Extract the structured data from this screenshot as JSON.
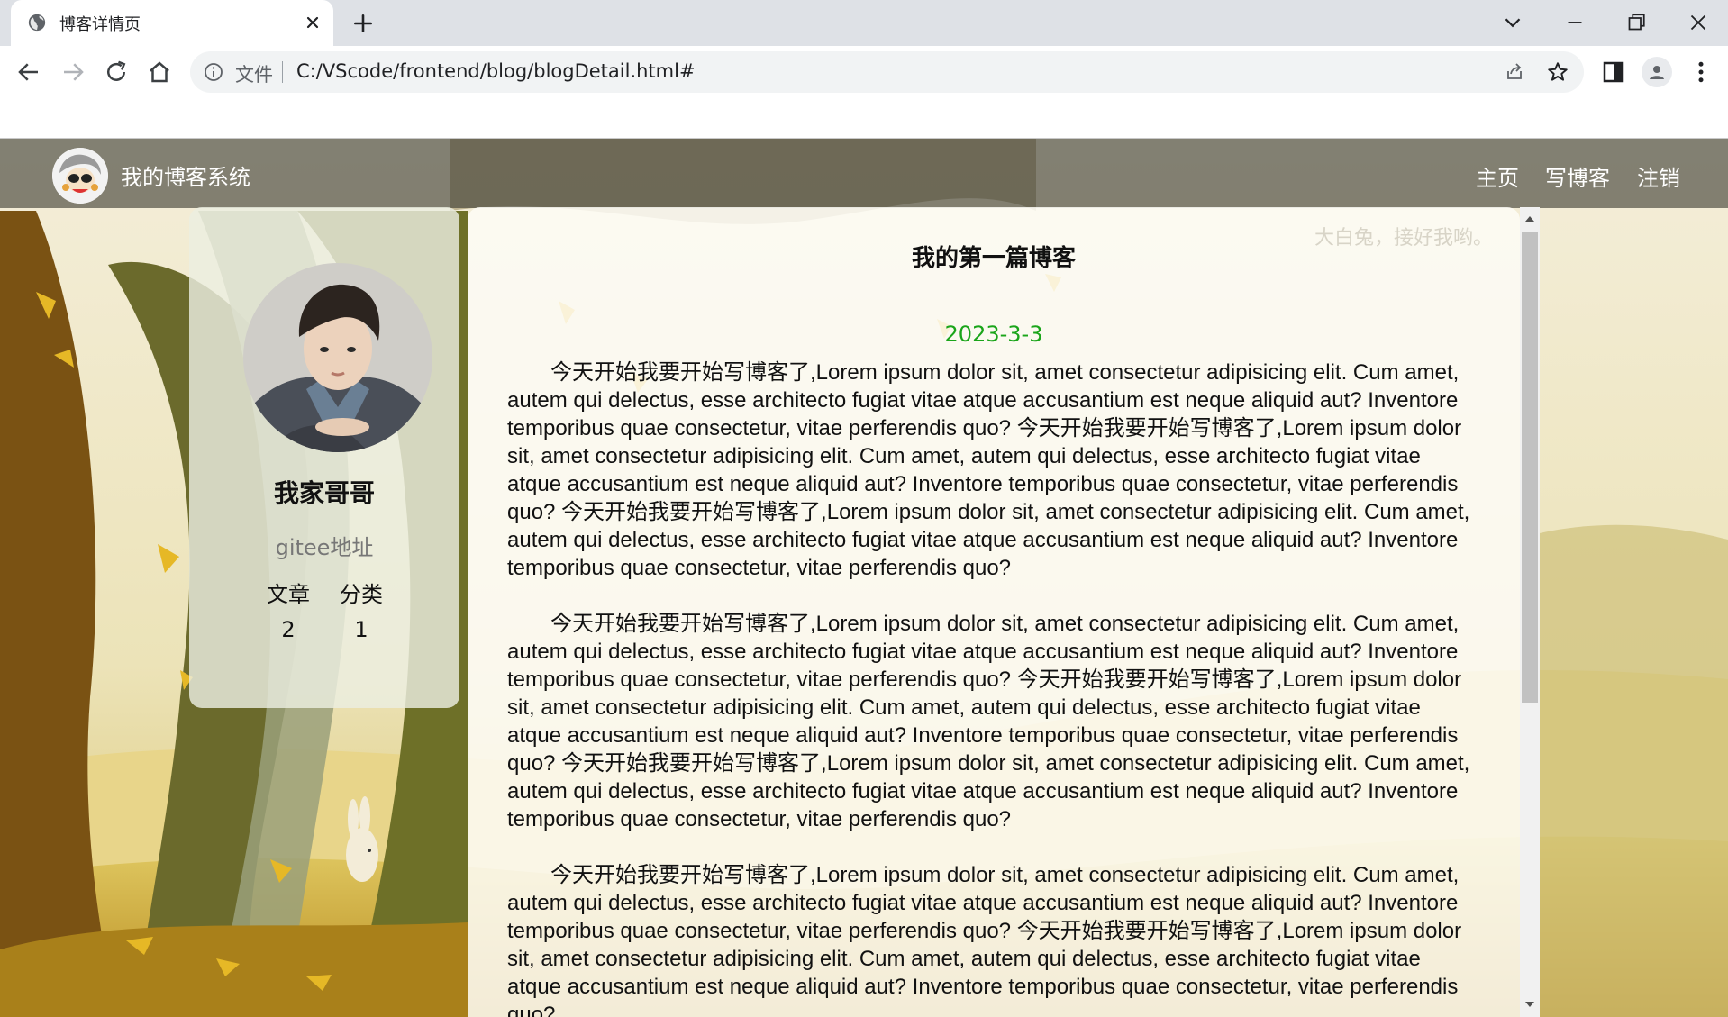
{
  "browser": {
    "tab_title": "博客详情页",
    "omnibox_file_label": "文件",
    "url": "C:/VScode/frontend/blog/blogDetail.html#"
  },
  "navbar": {
    "site_title": "我的博客系统",
    "links": [
      "主页",
      "写博客",
      "注销"
    ]
  },
  "profile": {
    "name": "我家哥哥",
    "gitee_link": "gitee地址",
    "stats": {
      "articles_label": "文章",
      "categories_label": "分类",
      "articles_count": "2",
      "categories_count": "1"
    }
  },
  "article": {
    "title": "我的第一篇博客",
    "date": "2023-3-3",
    "watermark": "大白兔，接好我哟。",
    "paragraphs": [
      "今天开始我要开始写博客了,Lorem ipsum dolor sit, amet consectetur adipisicing elit. Cum amet, autem qui delectus, esse architecto fugiat vitae atque accusantium est neque aliquid aut? Inventore temporibus quae consectetur, vitae perferendis quo? 今天开始我要开始写博客了,Lorem ipsum dolor sit, amet consectetur adipisicing elit. Cum amet, autem qui delectus, esse architecto fugiat vitae atque accusantium est neque aliquid aut? Inventore temporibus quae consectetur, vitae perferendis quo? 今天开始我要开始写博客了,Lorem ipsum dolor sit, amet consectetur adipisicing elit. Cum amet, autem qui delectus, esse architecto fugiat vitae atque accusantium est neque aliquid aut? Inventore temporibus quae consectetur, vitae perferendis quo?",
      "今天开始我要开始写博客了,Lorem ipsum dolor sit, amet consectetur adipisicing elit. Cum amet, autem qui delectus, esse architecto fugiat vitae atque accusantium est neque aliquid aut? Inventore temporibus quae consectetur, vitae perferendis quo? 今天开始我要开始写博客了,Lorem ipsum dolor sit, amet consectetur adipisicing elit. Cum amet, autem qui delectus, esse architecto fugiat vitae atque accusantium est neque aliquid aut? Inventore temporibus quae consectetur, vitae perferendis quo? 今天开始我要开始写博客了,Lorem ipsum dolor sit, amet consectetur adipisicing elit. Cum amet, autem qui delectus, esse architecto fugiat vitae atque accusantium est neque aliquid aut? Inventore temporibus quae consectetur, vitae perferendis quo?",
      "今天开始我要开始写博客了,Lorem ipsum dolor sit, amet consectetur adipisicing elit. Cum amet, autem qui delectus, esse architecto fugiat vitae atque accusantium est neque aliquid aut? Inventore temporibus quae consectetur, vitae perferendis quo? 今天开始我要开始写博客了,Lorem ipsum dolor sit, amet consectetur adipisicing elit. Cum amet, autem qui delectus, esse architecto fugiat vitae atque accusantium est neque aliquid aut? Inventore temporibus quae consectetur, vitae perferendis quo?"
    ]
  },
  "colors": {
    "date_green": "#1aa51a",
    "navbar_bg": "#5a5a48",
    "tabbar_bg": "#dee1e6"
  }
}
